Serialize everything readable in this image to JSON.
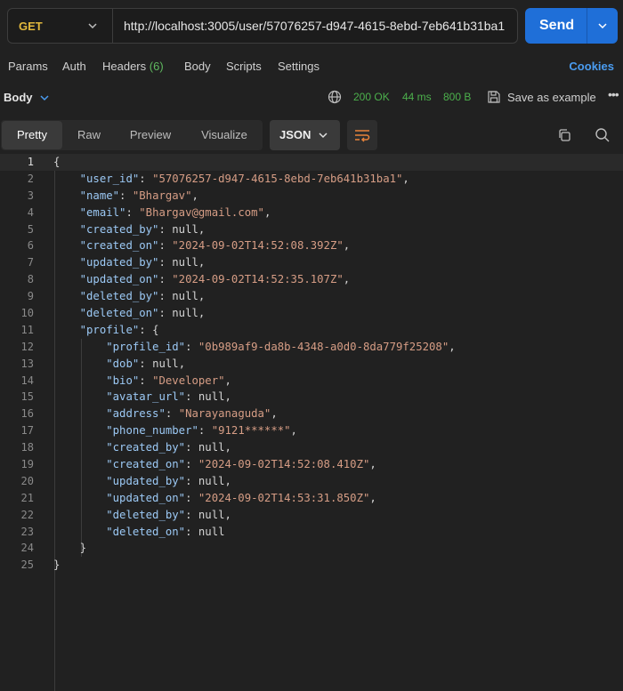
{
  "request": {
    "method": "GET",
    "url": "http://localhost:3005/user/57076257-d947-4615-8ebd-7eb641b31ba1",
    "send_label": "Send"
  },
  "request_tabs": {
    "params": "Params",
    "auth": "Auth",
    "headers": "Headers",
    "headers_count": "(6)",
    "body": "Body",
    "scripts": "Scripts",
    "settings": "Settings",
    "cookies": "Cookies"
  },
  "response": {
    "body_label": "Body",
    "status": "200 OK",
    "time": "44 ms",
    "size": "800 B",
    "save_example": "Save as example"
  },
  "view": {
    "modes": [
      "Pretty",
      "Raw",
      "Preview",
      "Visualize"
    ],
    "active_mode": "Pretty",
    "format": "JSON"
  },
  "code": {
    "line_numbers": [
      "1",
      "2",
      "3",
      "4",
      "5",
      "6",
      "7",
      "8",
      "9",
      "10",
      "11",
      "12",
      "13",
      "14",
      "15",
      "16",
      "17",
      "18",
      "19",
      "20",
      "21",
      "22",
      "23",
      "24",
      "25"
    ],
    "lines": [
      [
        {
          "t": "p",
          "v": "{"
        }
      ],
      [
        {
          "t": "p",
          "v": "    "
        },
        {
          "t": "k",
          "v": "\"user_id\""
        },
        {
          "t": "p",
          "v": ": "
        },
        {
          "t": "s",
          "v": "\"57076257-d947-4615-8ebd-7eb641b31ba1\""
        },
        {
          "t": "p",
          "v": ","
        }
      ],
      [
        {
          "t": "p",
          "v": "    "
        },
        {
          "t": "k",
          "v": "\"name\""
        },
        {
          "t": "p",
          "v": ": "
        },
        {
          "t": "s",
          "v": "\"Bhargav\""
        },
        {
          "t": "p",
          "v": ","
        }
      ],
      [
        {
          "t": "p",
          "v": "    "
        },
        {
          "t": "k",
          "v": "\"email\""
        },
        {
          "t": "p",
          "v": ": "
        },
        {
          "t": "s",
          "v": "\"Bhargav@gmail.com\""
        },
        {
          "t": "p",
          "v": ","
        }
      ],
      [
        {
          "t": "p",
          "v": "    "
        },
        {
          "t": "k",
          "v": "\"created_by\""
        },
        {
          "t": "p",
          "v": ": "
        },
        {
          "t": "n",
          "v": "null"
        },
        {
          "t": "p",
          "v": ","
        }
      ],
      [
        {
          "t": "p",
          "v": "    "
        },
        {
          "t": "k",
          "v": "\"created_on\""
        },
        {
          "t": "p",
          "v": ": "
        },
        {
          "t": "s",
          "v": "\"2024-09-02T14:52:08.392Z\""
        },
        {
          "t": "p",
          "v": ","
        }
      ],
      [
        {
          "t": "p",
          "v": "    "
        },
        {
          "t": "k",
          "v": "\"updated_by\""
        },
        {
          "t": "p",
          "v": ": "
        },
        {
          "t": "n",
          "v": "null"
        },
        {
          "t": "p",
          "v": ","
        }
      ],
      [
        {
          "t": "p",
          "v": "    "
        },
        {
          "t": "k",
          "v": "\"updated_on\""
        },
        {
          "t": "p",
          "v": ": "
        },
        {
          "t": "s",
          "v": "\"2024-09-02T14:52:35.107Z\""
        },
        {
          "t": "p",
          "v": ","
        }
      ],
      [
        {
          "t": "p",
          "v": "    "
        },
        {
          "t": "k",
          "v": "\"deleted_by\""
        },
        {
          "t": "p",
          "v": ": "
        },
        {
          "t": "n",
          "v": "null"
        },
        {
          "t": "p",
          "v": ","
        }
      ],
      [
        {
          "t": "p",
          "v": "    "
        },
        {
          "t": "k",
          "v": "\"deleted_on\""
        },
        {
          "t": "p",
          "v": ": "
        },
        {
          "t": "n",
          "v": "null"
        },
        {
          "t": "p",
          "v": ","
        }
      ],
      [
        {
          "t": "p",
          "v": "    "
        },
        {
          "t": "k",
          "v": "\"profile\""
        },
        {
          "t": "p",
          "v": ": {"
        }
      ],
      [
        {
          "t": "p",
          "v": "        "
        },
        {
          "t": "k",
          "v": "\"profile_id\""
        },
        {
          "t": "p",
          "v": ": "
        },
        {
          "t": "s",
          "v": "\"0b989af9-da8b-4348-a0d0-8da779f25208\""
        },
        {
          "t": "p",
          "v": ","
        }
      ],
      [
        {
          "t": "p",
          "v": "        "
        },
        {
          "t": "k",
          "v": "\"dob\""
        },
        {
          "t": "p",
          "v": ": "
        },
        {
          "t": "n",
          "v": "null"
        },
        {
          "t": "p",
          "v": ","
        }
      ],
      [
        {
          "t": "p",
          "v": "        "
        },
        {
          "t": "k",
          "v": "\"bio\""
        },
        {
          "t": "p",
          "v": ": "
        },
        {
          "t": "s",
          "v": "\"Developer\""
        },
        {
          "t": "p",
          "v": ","
        }
      ],
      [
        {
          "t": "p",
          "v": "        "
        },
        {
          "t": "k",
          "v": "\"avatar_url\""
        },
        {
          "t": "p",
          "v": ": "
        },
        {
          "t": "n",
          "v": "null"
        },
        {
          "t": "p",
          "v": ","
        }
      ],
      [
        {
          "t": "p",
          "v": "        "
        },
        {
          "t": "k",
          "v": "\"address\""
        },
        {
          "t": "p",
          "v": ": "
        },
        {
          "t": "s",
          "v": "\"Narayanaguda\""
        },
        {
          "t": "p",
          "v": ","
        }
      ],
      [
        {
          "t": "p",
          "v": "        "
        },
        {
          "t": "k",
          "v": "\"phone_number\""
        },
        {
          "t": "p",
          "v": ": "
        },
        {
          "t": "s",
          "v": "\"9121******\""
        },
        {
          "t": "p",
          "v": ","
        }
      ],
      [
        {
          "t": "p",
          "v": "        "
        },
        {
          "t": "k",
          "v": "\"created_by\""
        },
        {
          "t": "p",
          "v": ": "
        },
        {
          "t": "n",
          "v": "null"
        },
        {
          "t": "p",
          "v": ","
        }
      ],
      [
        {
          "t": "p",
          "v": "        "
        },
        {
          "t": "k",
          "v": "\"created_on\""
        },
        {
          "t": "p",
          "v": ": "
        },
        {
          "t": "s",
          "v": "\"2024-09-02T14:52:08.410Z\""
        },
        {
          "t": "p",
          "v": ","
        }
      ],
      [
        {
          "t": "p",
          "v": "        "
        },
        {
          "t": "k",
          "v": "\"updated_by\""
        },
        {
          "t": "p",
          "v": ": "
        },
        {
          "t": "n",
          "v": "null"
        },
        {
          "t": "p",
          "v": ","
        }
      ],
      [
        {
          "t": "p",
          "v": "        "
        },
        {
          "t": "k",
          "v": "\"updated_on\""
        },
        {
          "t": "p",
          "v": ": "
        },
        {
          "t": "s",
          "v": "\"2024-09-02T14:53:31.850Z\""
        },
        {
          "t": "p",
          "v": ","
        }
      ],
      [
        {
          "t": "p",
          "v": "        "
        },
        {
          "t": "k",
          "v": "\"deleted_by\""
        },
        {
          "t": "p",
          "v": ": "
        },
        {
          "t": "n",
          "v": "null"
        },
        {
          "t": "p",
          "v": ","
        }
      ],
      [
        {
          "t": "p",
          "v": "        "
        },
        {
          "t": "k",
          "v": "\"deleted_on\""
        },
        {
          "t": "p",
          "v": ": "
        },
        {
          "t": "n",
          "v": "null"
        }
      ],
      [
        {
          "t": "p",
          "v": "    }"
        }
      ],
      [
        {
          "t": "p",
          "v": "}"
        }
      ]
    ]
  },
  "colors": {
    "background": "#212121",
    "send_button": "#1f6fd8",
    "method_get": "#e2b93d",
    "status_ok": "#4cb04c",
    "json_key": "#9cc9f5",
    "json_string": "#d69d85",
    "cookies_link": "#4a9cf0"
  },
  "icons": {
    "method_dropdown": "chevron-down-icon",
    "send_dropdown": "chevron-down-icon",
    "network": "globe-icon",
    "save": "save-icon",
    "more": "more-horizontal-icon",
    "wrap": "wrap-lines-icon",
    "copy": "copy-icon",
    "search": "search-icon"
  }
}
